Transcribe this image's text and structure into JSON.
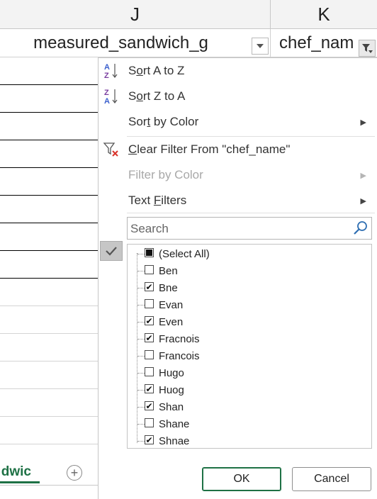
{
  "columns": {
    "j": {
      "letter": "J",
      "header": "measured_sandwich_g"
    },
    "k": {
      "letter": "K",
      "header": "chef_nam"
    }
  },
  "sheet_tab": {
    "label": "dwic"
  },
  "add_sheet_icon": "plus-circle-icon",
  "menu": {
    "sort_a_z": {
      "prefix": "S",
      "u": "o",
      "rest": "rt A to Z"
    },
    "sort_z_a": {
      "prefix": "S",
      "u": "o",
      "rest": "rt Z to A"
    },
    "sort_by_color": {
      "prefix": "Sor",
      "u": "t",
      "rest": " by Color"
    },
    "clear_filter": {
      "prefix": "",
      "u": "C",
      "rest": "lear Filter From \"chef_name\""
    },
    "filter_by_color": "Filter by Color",
    "text_filters": {
      "prefix": "Text ",
      "u": "F",
      "rest": "ilters"
    },
    "search_placeholder": "Search",
    "items": [
      {
        "label": "(Select All)",
        "state": "mixed"
      },
      {
        "label": "Ben",
        "state": "unchecked"
      },
      {
        "label": "Bne",
        "state": "checked"
      },
      {
        "label": "Evan",
        "state": "unchecked"
      },
      {
        "label": "Even",
        "state": "checked"
      },
      {
        "label": "Fracnois",
        "state": "checked"
      },
      {
        "label": "Francois",
        "state": "unchecked"
      },
      {
        "label": "Hugo",
        "state": "unchecked"
      },
      {
        "label": "Huog",
        "state": "checked"
      },
      {
        "label": "Shan",
        "state": "checked"
      },
      {
        "label": "Shane",
        "state": "unchecked"
      },
      {
        "label": "Shnae",
        "state": "checked"
      }
    ],
    "ok_label": "OK",
    "cancel_label": "Cancel"
  },
  "colors": {
    "accent": "#1e7145",
    "sort_icon_blue": "#3a5fcd",
    "sort_icon_purple": "#7b3fa0",
    "clear_icon_red": "#d9342b"
  }
}
